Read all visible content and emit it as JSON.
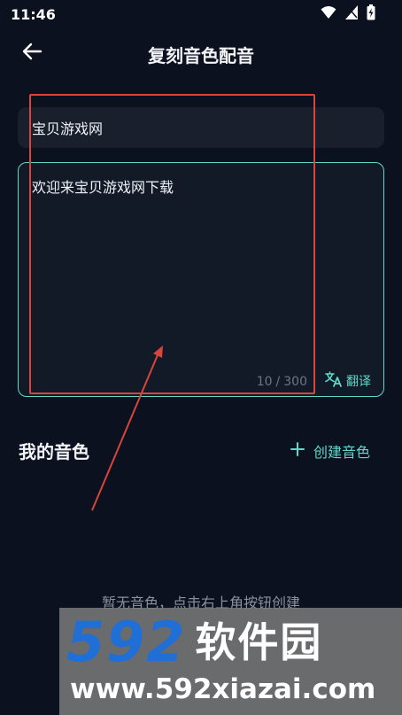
{
  "status_bar": {
    "time": "11:46",
    "icons": [
      "wifi-icon",
      "no-sim-icon",
      "battery-charging-icon"
    ]
  },
  "header": {
    "back_icon": "arrow-left-icon",
    "title": "复刻音色配音"
  },
  "voice_name": {
    "value": "宝贝游戏网"
  },
  "text_input": {
    "value": "欢迎来宝贝游戏网下载",
    "char_count": "10",
    "char_limit": "300",
    "separator": "/",
    "translate_label": "翻译",
    "translate_icon": "translate-icon",
    "border_color": "#5fd8cc"
  },
  "my_voices": {
    "title": "我的音色",
    "create_label": "创建音色",
    "create_icon": "plus-icon",
    "empty_hint": "暂无音色，点击右上角按钮创建"
  },
  "watermark": {
    "digits": "592",
    "name": "软件园",
    "url": "www.592xiazai.com"
  },
  "colors": {
    "background": "#0c1120",
    "accent": "#5fd8cc",
    "annotation": "#d9453a"
  }
}
